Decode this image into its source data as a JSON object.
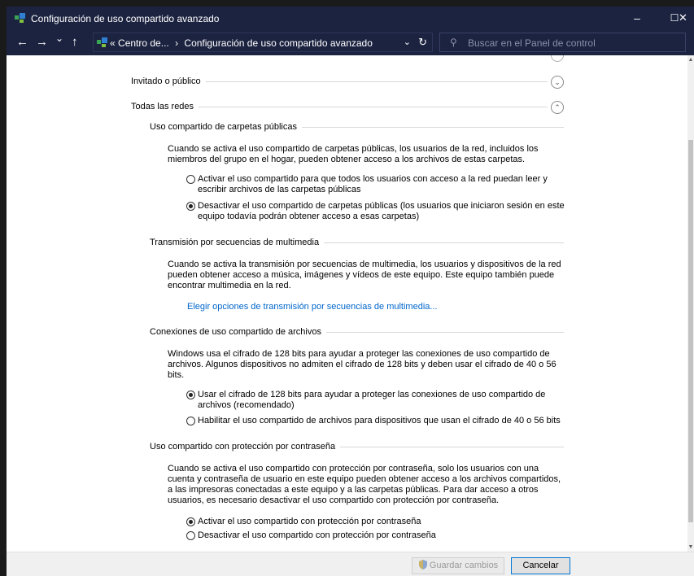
{
  "window": {
    "title": "Configuración de uso compartido avanzado",
    "minimize": "–",
    "maximize": "☐",
    "close": "✕"
  },
  "addressbar": {
    "back": "←",
    "forward": "→",
    "recent": "⌄",
    "up": "↑",
    "breadcrumb_prefix": "«",
    "crumb1": "Centro de...",
    "separator": "›",
    "crumb2": "Configuración de uso compartido avanzado",
    "dropdown": "⌄",
    "refresh": "↻",
    "search_icon": "⚲",
    "search_placeholder": "Buscar en el Panel de control"
  },
  "sections": {
    "guest": {
      "label": "Invitado o público",
      "toggle": "⌄"
    },
    "all": {
      "label": "Todas las redes",
      "toggle": "⌃"
    }
  },
  "public_folders": {
    "heading": "Uso compartido de carpetas públicas",
    "desc": "Cuando se activa el uso compartido de carpetas públicas, los usuarios de la red, incluidos los miembros del grupo en el hogar, pueden obtener acceso a los archivos de estas carpetas.",
    "opt1": "Activar el uso compartido para que todos los usuarios con acceso a la red puedan leer y escribir archivos de las carpetas públicas",
    "opt2": "Desactivar el uso compartido de carpetas públicas (los usuarios que iniciaron sesión en este equipo todavía podrán obtener acceso a esas carpetas)"
  },
  "streaming": {
    "heading": "Transmisión por secuencias de multimedia",
    "desc": "Cuando se activa la transmisión por secuencias de multimedia, los usuarios y dispositivos de la red pueden obtener acceso a música, imágenes y vídeos de este equipo. Este equipo también puede encontrar multimedia en la red.",
    "link": "Elegir opciones de transmisión por secuencias de multimedia..."
  },
  "file_sharing": {
    "heading": "Conexiones de uso compartido de archivos",
    "desc": "Windows usa el cifrado de 128 bits para ayudar a proteger las conexiones de uso compartido de archivos. Algunos dispositivos no admiten el cifrado de 128 bits y deben usar el cifrado de 40 o 56 bits.",
    "opt1": "Usar el cifrado de 128 bits para ayudar a proteger las conexiones de uso compartido de archivos (recomendado)",
    "opt2": "Habilitar el uso compartido de archivos para dispositivos que usan el cifrado de 40 o 56 bits"
  },
  "password": {
    "heading": "Uso compartido con protección por contraseña",
    "desc": "Cuando se activa el uso compartido con protección por contraseña, solo los usuarios con una cuenta y contraseña de usuario en este equipo pueden obtener acceso a los archivos compartidos, a las impresoras conectadas a este equipo y a las carpetas públicas. Para dar acceso a otros usuarios, es necesario desactivar el uso compartido con protección por contraseña.",
    "opt1": "Activar el uso compartido con protección por contraseña",
    "opt2": "Desactivar el uso compartido con protección por contraseña"
  },
  "footer": {
    "save": "Guardar cambios",
    "cancel": "Cancelar"
  },
  "colors": {
    "titlebar": "#1c2340",
    "link": "#0066cc",
    "accent": "#0078d7"
  }
}
